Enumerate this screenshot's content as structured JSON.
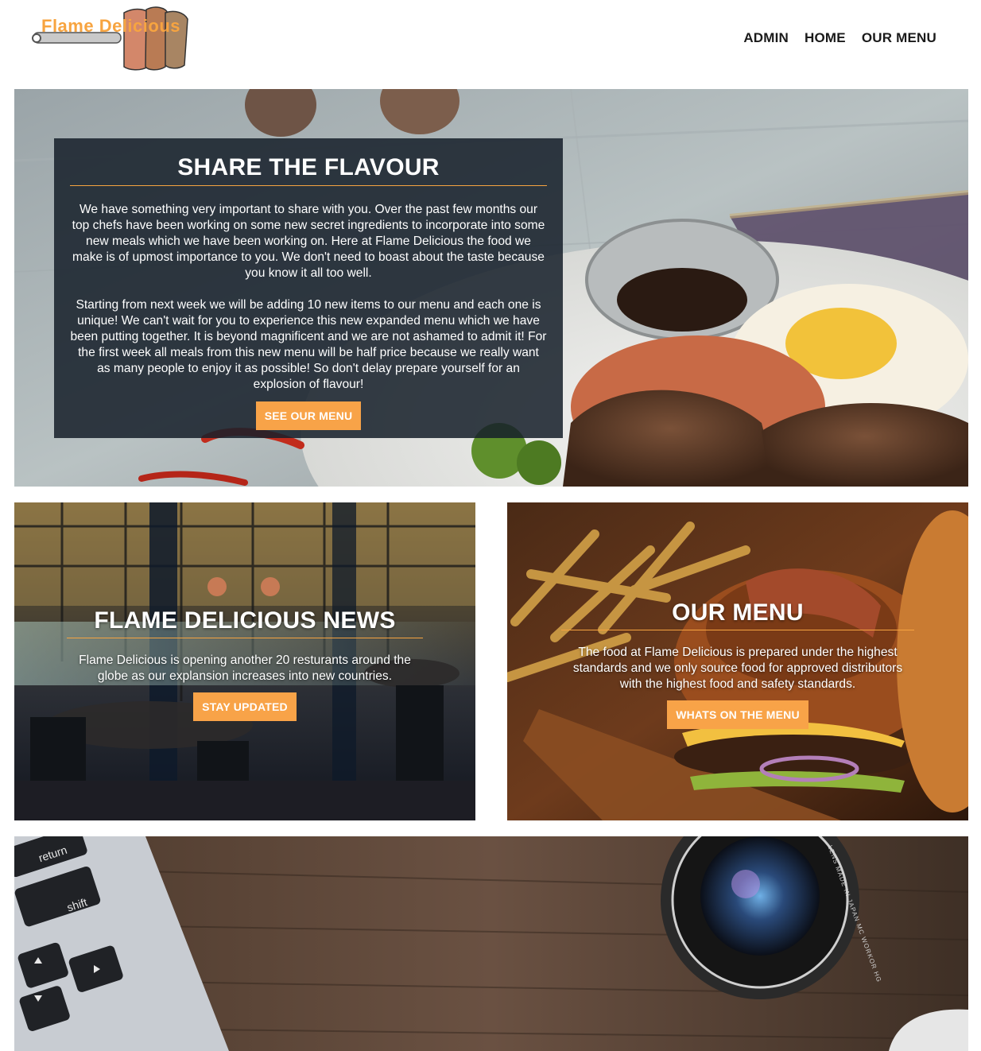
{
  "brand": {
    "logo_text": "Flame Delicious"
  },
  "nav": {
    "items": [
      "ADMIN",
      "HOME",
      "OUR MENU"
    ]
  },
  "hero": {
    "title": "SHARE THE FLAVOUR",
    "paragraph1": "We have something very important to share with you. Over the past few months our top chefs have been working on some new secret ingredients to incorporate into some new meals which we have been working on. Here at Flame Delicious the food we make is of upmost importance to you. We don't need to boast about the taste because you know it all too well.",
    "paragraph2": "Starting from next week we will be adding 10 new items to our menu and each one is unique! We can't wait for you to experience this new expanded menu which we have been putting together. It is beyond magnificent and we are not ashamed to admit it! For the first week all meals from this new menu will be half price because we really want as many people to enjoy it as possible! So don't delay prepare yourself for an explosion of flavour!",
    "button": "SEE OUR MENU"
  },
  "news": {
    "title": "FLAME DELICIOUS NEWS",
    "text": "Flame Delicious is opening another 20 resturants around the globe as our explansion increases into new countries.",
    "button": "STAY UPDATED"
  },
  "menu": {
    "title": "OUR MENU",
    "text": "The food at Flame Delicious is prepared under the highest standards and we only source food for approved distributors with the highest food and safety standards.",
    "button": "WHATS ON THE MENU"
  },
  "photo_text": {
    "key_return": "return",
    "key_shift": "shift",
    "lens_text": "LENS MADE IN JAPAN  MC WORKOR HG"
  },
  "colors": {
    "accent": "#f8a348",
    "hero_box": "#16202a",
    "nav_text": "#1a1a1a"
  }
}
